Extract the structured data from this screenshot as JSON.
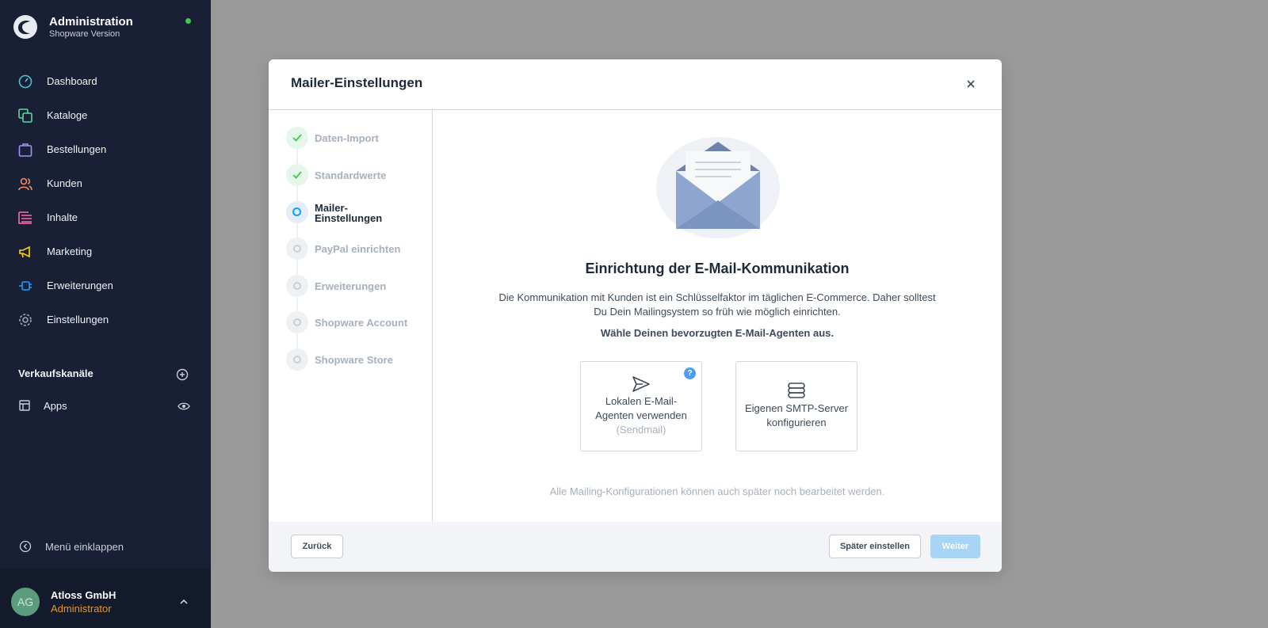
{
  "app": {
    "title": "Administration",
    "subtitle": "Shopware Version"
  },
  "sidebar": {
    "items": [
      {
        "label": "Dashboard",
        "icon": "dashboard-icon"
      },
      {
        "label": "Kataloge",
        "icon": "catalog-icon"
      },
      {
        "label": "Bestellungen",
        "icon": "orders-icon"
      },
      {
        "label": "Kunden",
        "icon": "customers-icon"
      },
      {
        "label": "Inhalte",
        "icon": "content-icon"
      },
      {
        "label": "Marketing",
        "icon": "marketing-icon"
      },
      {
        "label": "Erweiterungen",
        "icon": "extensions-icon"
      },
      {
        "label": "Einstellungen",
        "icon": "settings-icon"
      }
    ],
    "sales_channels_heading": "Verkaufskanäle",
    "apps_label": "Apps",
    "collapse_label": "Menü einklappen",
    "colors": {
      "background": "#192036",
      "dashboard": "#4dc2cd",
      "catalog": "#57d9a3",
      "orders": "#a092f0",
      "customers": "#f88962",
      "content": "#ff68b4",
      "marketing": "#ffd700",
      "extensions": "#189eff",
      "settings": "#9aa8b5"
    }
  },
  "user": {
    "initials": "AG",
    "name": "Atloss GmbH",
    "role": "Administrator"
  },
  "modal": {
    "title": "Mailer-Einstellungen",
    "steps": [
      {
        "label": "Daten-Import",
        "state": "done"
      },
      {
        "label": "Standardwerte",
        "state": "done"
      },
      {
        "label": "Mailer-Einstellungen",
        "state": "active"
      },
      {
        "label": "PayPal einrichten",
        "state": "pending"
      },
      {
        "label": "Erweiterungen",
        "state": "pending"
      },
      {
        "label": "Shopware Account",
        "state": "pending"
      },
      {
        "label": "Shopware Store",
        "state": "pending"
      }
    ],
    "headline": "Einrichtung der E-Mail-Kommunikation",
    "description": "Die Kommunikation mit Kunden ist ein Schlüsselfaktor im täglichen E-Commerce. Daher solltest Du Dein Mailingsystem so früh wie möglich einrichten.",
    "prompt": "Wähle Deinen bevorzugten E-Mail-Agenten aus.",
    "choices": {
      "local": {
        "label": "Lokalen E-Mail-Agenten verwenden",
        "sub": "(Sendmail)",
        "help": "?"
      },
      "smtp": {
        "label": "Eigenen SMTP-Server konfigurieren"
      }
    },
    "footnote": "Alle Mailing-Konfigurationen können auch später noch bearbeitet werden.",
    "buttons": {
      "back": "Zurück",
      "later": "Später einstellen",
      "next": "Weiter"
    }
  }
}
